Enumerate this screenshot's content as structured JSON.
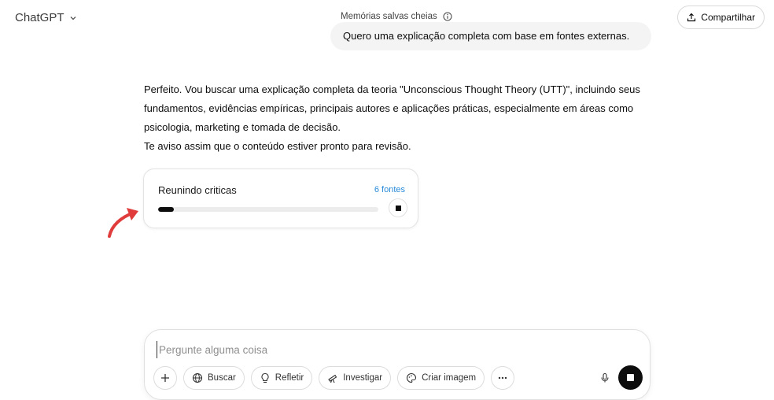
{
  "header": {
    "brand": "ChatGPT",
    "memories_notice": "Memórias salvas cheias",
    "share_label": "Compartilhar"
  },
  "conversation": {
    "user_message": "Quero uma explicação completa com base em fontes externas.",
    "assistant_lines": [
      "Perfeito. Vou buscar uma explicação completa da teoria \"Unconscious Thought Theory (UTT)\", incluindo seus",
      "fundamentos, evidências empíricas, principais autores e aplicações práticas, especialmente em áreas como",
      "psicologia, marketing e tomada de decisão.",
      "Te aviso assim que o conteúdo estiver pronto para revisão."
    ]
  },
  "research": {
    "status": "Reunindo criticas",
    "sources": "6 fontes",
    "progress": 0.07
  },
  "composer": {
    "placeholder": "Pergunte alguma coisa",
    "value": "",
    "tools": [
      {
        "label": "Buscar",
        "icon": "globe-icon"
      },
      {
        "label": "Refletir",
        "icon": "lightbulb-icon"
      },
      {
        "label": "Investigar",
        "icon": "telescope-icon"
      },
      {
        "label": "Criar imagem",
        "icon": "palette-icon"
      }
    ]
  },
  "colors": {
    "accent_link": "#2a8bd8",
    "annotation_arrow": "#e03c3c",
    "bubble_bg": "#f4f4f4"
  }
}
